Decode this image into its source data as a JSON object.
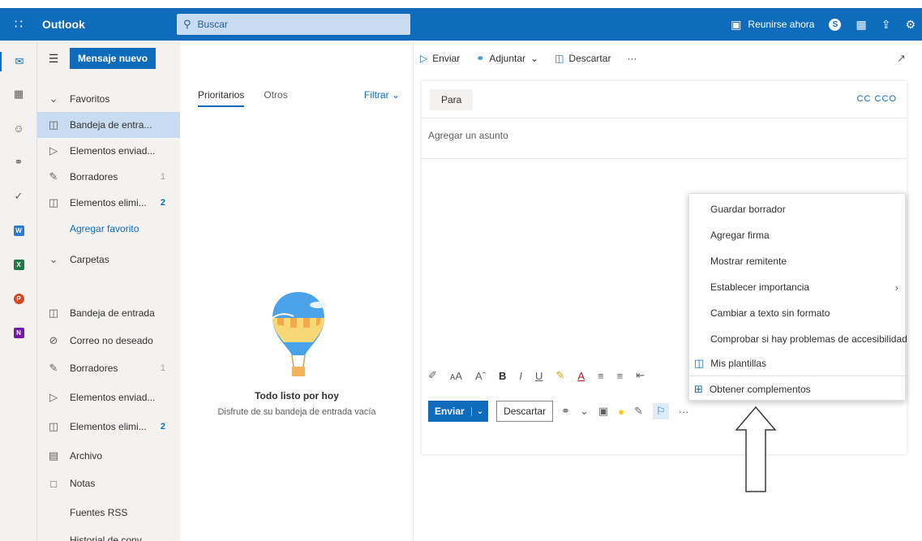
{
  "topbar": {
    "app_name": "Outlook",
    "search_placeholder": "Buscar",
    "meet_label": "Reunirse ahora"
  },
  "toolbar": {
    "new_mail": "Mensaje nuevo",
    "send": "Enviar",
    "attach": "Adjuntar",
    "discard": "Descartar",
    "more": "···"
  },
  "folders": {
    "favorites_header": "Favoritos",
    "folders_header": "Carpetas",
    "add_favorite": "Agregar favorito",
    "favorites": [
      {
        "label": "Bandeja de entra...",
        "count": ""
      },
      {
        "label": "Elementos enviad...",
        "count": ""
      },
      {
        "label": "Borradores",
        "count": "1"
      },
      {
        "label": "Elementos elimi...",
        "count": "2"
      }
    ],
    "items": [
      {
        "label": "Bandeja de entrada",
        "count": ""
      },
      {
        "label": "Correo no deseado",
        "count": ""
      },
      {
        "label": "Borradores",
        "count": "1"
      },
      {
        "label": "Elementos enviad...",
        "count": ""
      },
      {
        "label": "Elementos elimi...",
        "count": "2"
      },
      {
        "label": "Archivo",
        "count": ""
      },
      {
        "label": "Notas",
        "count": ""
      },
      {
        "label": "Fuentes RSS",
        "count": ""
      },
      {
        "label": "Historial de conv...",
        "count": ""
      }
    ]
  },
  "message_list": {
    "tab_focused": "Prioritarios",
    "tab_other": "Otros",
    "filter": "Filtrar",
    "empty_title": "Todo listo por hoy",
    "empty_subtitle": "Disfrute de su bandeja de entrada vacía"
  },
  "compose": {
    "to_button": "Para",
    "cc_bcc": "CC  CCO",
    "subject_placeholder": "Agregar un asunto",
    "send_button": "Enviar",
    "discard_button": "Descartar",
    "more": "···"
  },
  "menu": {
    "items": [
      "Guardar borrador",
      "Agregar firma",
      "Mostrar remitente",
      "Establecer importancia",
      "Cambiar a texto sin formato",
      "Comprobar si hay problemas de accesibilidad",
      "Mis plantillas",
      "Obtener complementos"
    ]
  },
  "colors": {
    "brand": "#0f6cbd",
    "selected": "#c7dcf1"
  }
}
